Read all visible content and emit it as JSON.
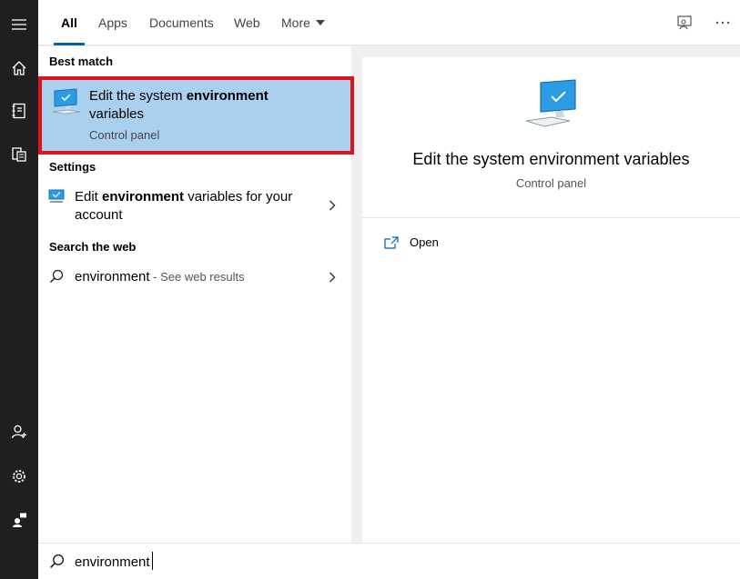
{
  "tabs": [
    {
      "label": "All",
      "active": true
    },
    {
      "label": "Apps",
      "active": false
    },
    {
      "label": "Documents",
      "active": false
    },
    {
      "label": "Web",
      "active": false
    },
    {
      "label": "More",
      "active": false
    }
  ],
  "top_icons": [
    "feedback-icon",
    "more-options-icon"
  ],
  "rail_icons": [
    "hamburger-menu-icon",
    "home-icon",
    "notebook-icon",
    "documents-icon",
    "add-person-icon",
    "settings-gear-icon",
    "feedback-person-icon"
  ],
  "sections": {
    "best_match": "Best match",
    "settings": "Settings",
    "search_web": "Search the web"
  },
  "best_match": {
    "title_prefix": "Edit the system ",
    "title_bold": "environment",
    "title_suffix": "variables",
    "subtitle": "Control panel",
    "icon": "monitor-icon"
  },
  "settings_item": {
    "prefix": "Edit ",
    "bold": "environment",
    "suffix": " variables for your",
    "line2": "account",
    "icon": "monitor-icon"
  },
  "web_item": {
    "query": "environment",
    "suffix": " - See web results",
    "icon": "search-icon"
  },
  "preview": {
    "title": "Edit the system environment variables",
    "subtitle": "Control panel",
    "action_open": "Open"
  },
  "search": {
    "value": "environment"
  },
  "colors": {
    "accent": "#0063b1",
    "highlight": "#aad0ef",
    "highlight_border": "#e0121c",
    "rail": "#1f1f1f"
  }
}
